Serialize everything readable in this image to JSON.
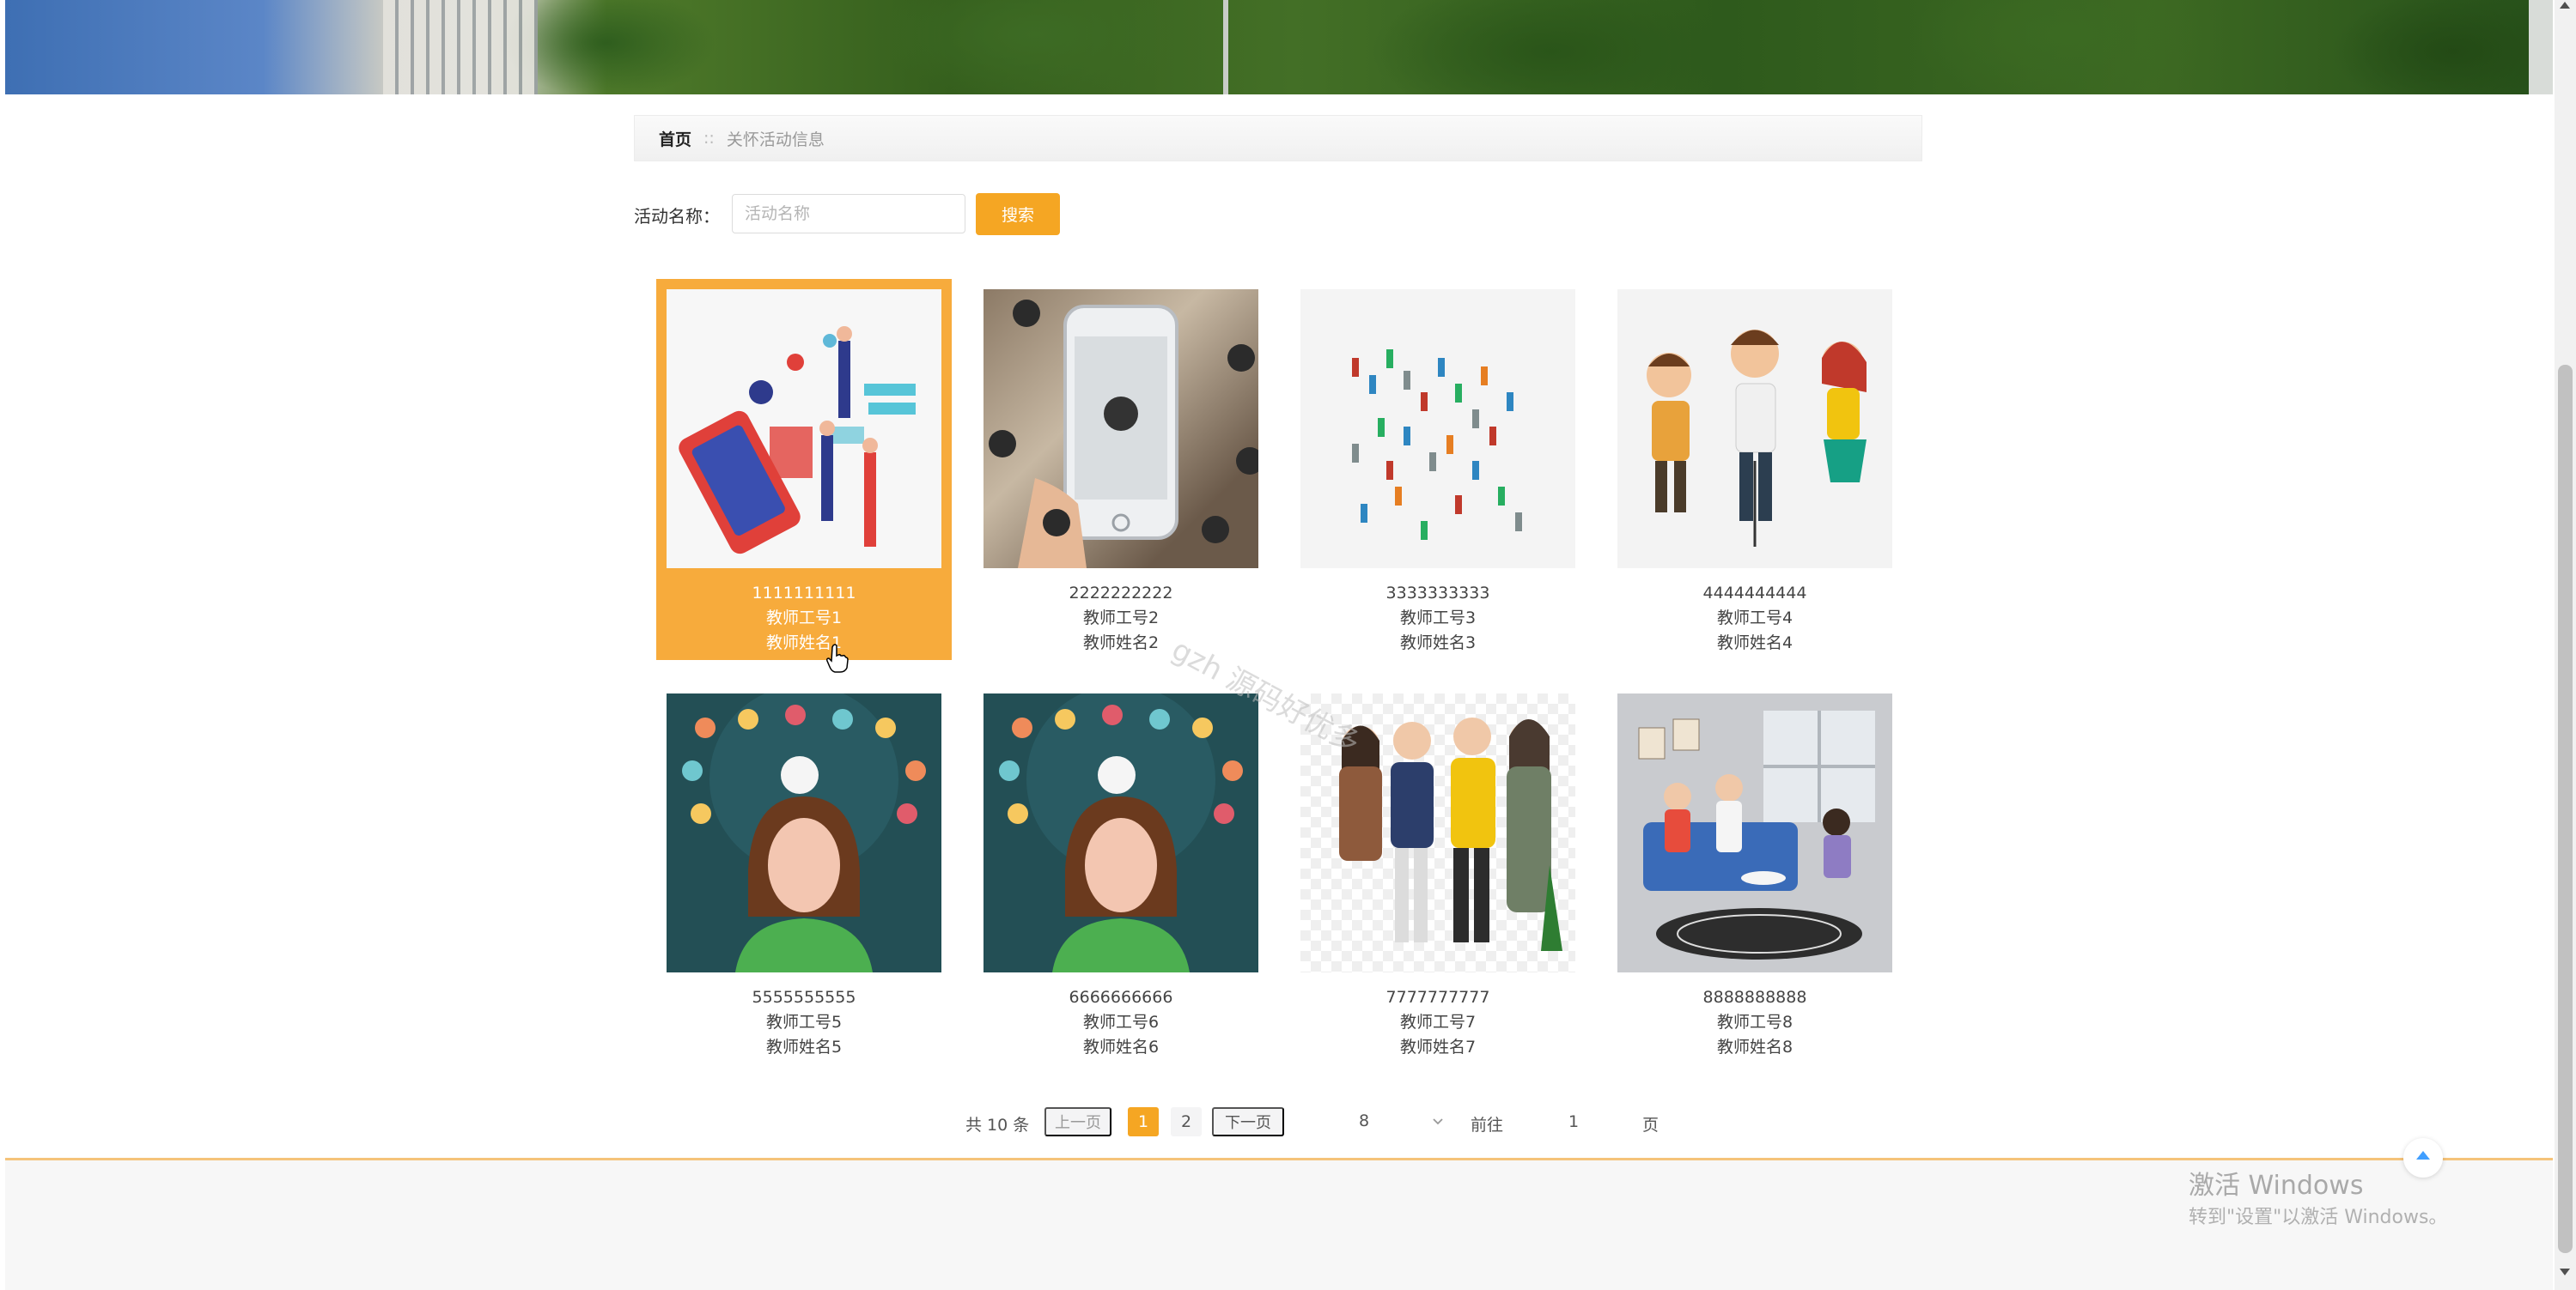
{
  "breadcrumb": {
    "home": "首页",
    "separator": "::",
    "current": "关怀活动信息"
  },
  "search": {
    "label": "活动名称：",
    "placeholder": "活动名称",
    "value": "",
    "button_label": "搜索"
  },
  "cards": [
    {
      "title": "1111111111",
      "teacher_id": "教师工号1",
      "teacher_name": "教师姓名1",
      "active": true
    },
    {
      "title": "2222222222",
      "teacher_id": "教师工号2",
      "teacher_name": "教师姓名2",
      "active": false
    },
    {
      "title": "3333333333",
      "teacher_id": "教师工号3",
      "teacher_name": "教师姓名3",
      "active": false
    },
    {
      "title": "4444444444",
      "teacher_id": "教师工号4",
      "teacher_name": "教师姓名4",
      "active": false
    },
    {
      "title": "5555555555",
      "teacher_id": "教师工号5",
      "teacher_name": "教师姓名5",
      "active": false
    },
    {
      "title": "6666666666",
      "teacher_id": "教师工号6",
      "teacher_name": "教师姓名6",
      "active": false
    },
    {
      "title": "7777777777",
      "teacher_id": "教师工号7",
      "teacher_name": "教师姓名7",
      "active": false
    },
    {
      "title": "8888888888",
      "teacher_id": "教师工号8",
      "teacher_name": "教师姓名8",
      "active": false
    }
  ],
  "pagination": {
    "total_text": "共 10 条",
    "prev_label": "上一页",
    "next_label": "下一页",
    "pages": [
      "1",
      "2"
    ],
    "current_page": "1",
    "page_size": "8",
    "goto_label": "前往",
    "goto_value": "1",
    "page_suffix": "页"
  },
  "watermark": "gzh 源码好优多",
  "windows_activation": {
    "title": "激活 Windows",
    "hint": "转到\"设置\"以激活 Windows。"
  },
  "colors": {
    "accent": "#f5a623",
    "card_active": "#f7ab3c",
    "footer_line": "#f5c37a",
    "back_top_icon": "#409eff"
  },
  "icons": {
    "back_to_top": "chevron-up-icon",
    "dropdown": "chevron-down-icon",
    "cursor": "hand-pointer-icon"
  }
}
